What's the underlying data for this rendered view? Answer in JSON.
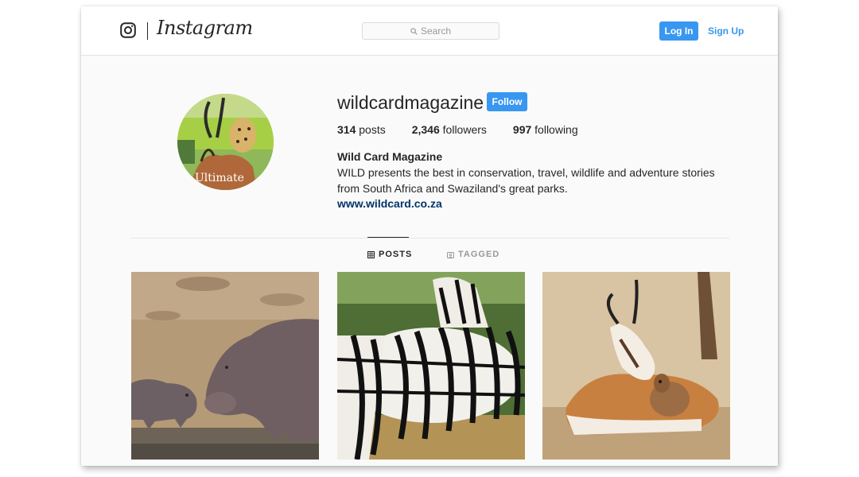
{
  "header": {
    "logo_text": "Instagram",
    "search_placeholder": "Search",
    "login_label": "Log In",
    "signup_label": "Sign Up"
  },
  "profile": {
    "username": "wildcardmagazine",
    "follow_label": "Follow",
    "stats": {
      "posts_count": "314",
      "posts_label": "posts",
      "followers_count": "2,346",
      "followers_label": "followers",
      "following_count": "997",
      "following_label": "following"
    },
    "full_name": "Wild Card Magazine",
    "bio": "WILD presents the best in conservation, travel, wildlife and adventure stories from South Africa and Swaziland's great parks.",
    "website": "www.wildcard.co.za",
    "avatar_text": "Ultimate"
  },
  "tabs": [
    {
      "label": "POSTS",
      "icon": "grid-icon",
      "active": true
    },
    {
      "label": "TAGGED",
      "icon": "tag-icon",
      "active": false
    }
  ],
  "posts": [
    {
      "subject": "hippos"
    },
    {
      "subject": "zebras"
    },
    {
      "subject": "springbok"
    }
  ],
  "colors": {
    "accent": "#3897f0",
    "link": "#003569",
    "text": "#262626",
    "muted": "#999999",
    "background": "#fafafa"
  }
}
